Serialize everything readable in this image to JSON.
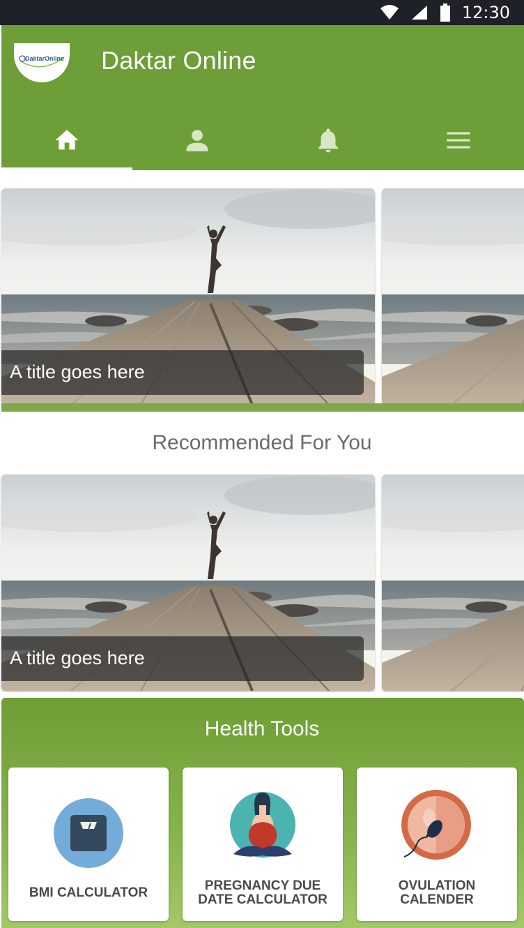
{
  "status_bar": {
    "time": "12:30",
    "icons": [
      "wifi-icon",
      "signal-icon",
      "battery-icon"
    ]
  },
  "app": {
    "title": "Daktar Online",
    "logo_text": "DaktarOnline",
    "brand_color": "#6d9e37"
  },
  "tabs": [
    {
      "name": "home",
      "icon": "home-icon",
      "active": true
    },
    {
      "name": "profile",
      "icon": "person-icon",
      "active": false
    },
    {
      "name": "notifications",
      "icon": "bell-icon",
      "active": false
    },
    {
      "name": "menu",
      "icon": "menu-icon",
      "active": false
    }
  ],
  "featured": {
    "cards": [
      {
        "caption": "A title goes here"
      }
    ]
  },
  "recommended": {
    "title": "Recommended For You",
    "cards": [
      {
        "caption": "A title goes here"
      }
    ]
  },
  "health_tools": {
    "title": "Health Tools",
    "items": [
      {
        "label": "BMI CALCULATOR",
        "icon": "scale-icon"
      },
      {
        "label_line1": "PREGNANCY DUE",
        "label_line2": "DATE CALCULATOR",
        "icon": "pregnant-woman-icon"
      },
      {
        "label_line1": "OVULATION",
        "label_line2": "CALENDER",
        "icon": "ovum-icon"
      }
    ]
  }
}
